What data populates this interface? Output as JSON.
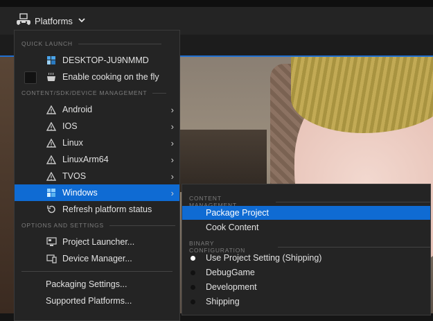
{
  "toolbar": {
    "platforms_label": "Platforms",
    "platforms_icon": "gamepad-icon"
  },
  "menu": {
    "quick_launch_header": "QUICK LAUNCH",
    "device_label": "DESKTOP-JU9NMMD",
    "cooking_label": "Enable cooking on the fly",
    "content_header": "CONTENT/SDK/DEVICE MANAGEMENT",
    "platforms": [
      {
        "label": "Android",
        "icon": "warning-icon"
      },
      {
        "label": "IOS",
        "icon": "warning-icon"
      },
      {
        "label": "Linux",
        "icon": "warning-icon"
      },
      {
        "label": "LinuxArm64",
        "icon": "warning-icon"
      },
      {
        "label": "TVOS",
        "icon": "warning-icon"
      },
      {
        "label": "Windows",
        "icon": "windows-icon"
      }
    ],
    "refresh_label": "Refresh platform status",
    "options_header": "OPTIONS AND SETTINGS",
    "project_launcher_label": "Project Launcher...",
    "device_manager_label": "Device Manager...",
    "packaging_settings_label": "Packaging Settings...",
    "supported_platforms_label": "Supported Platforms..."
  },
  "submenu": {
    "content_header": "CONTENT MANAGEMENT",
    "package_project_label": "Package Project",
    "cook_content_label": "Cook Content",
    "binary_header": "BINARY CONFIGURATION",
    "configs": [
      {
        "label": "Use Project Setting (Shipping)",
        "selected": true
      },
      {
        "label": "DebugGame",
        "selected": false
      },
      {
        "label": "Development",
        "selected": false
      },
      {
        "label": "Shipping",
        "selected": false
      }
    ]
  },
  "colors": {
    "accent": "#0f6bd3",
    "menu_bg": "#242424"
  }
}
